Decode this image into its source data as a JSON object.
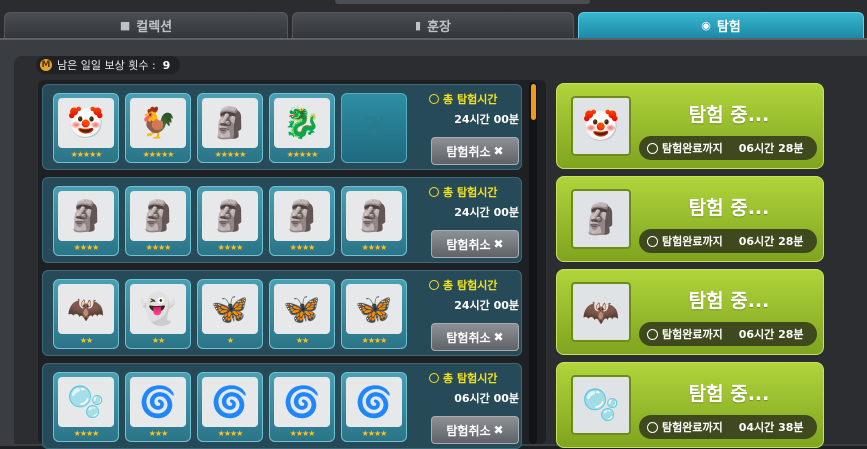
{
  "tabs": [
    {
      "label": "컬렉션",
      "icon": "box-icon"
    },
    {
      "label": "훈장",
      "icon": "bookmark-icon"
    },
    {
      "label": "탐험",
      "icon": "map-pin-icon"
    }
  ],
  "reward": {
    "label": "남은 일일 보상 횟수 :",
    "count": "9",
    "coin_letter": "M"
  },
  "rows": [
    {
      "time_label": "총 탐험시간",
      "time_value": "24시간 00분",
      "cancel": "탐험취소",
      "slots": [
        {
          "stars": "★★★★★"
        },
        {
          "stars": "★★★★★"
        },
        {
          "stars": "★★★★★"
        },
        {
          "stars": "★★★★★"
        },
        {
          "empty": true
        }
      ]
    },
    {
      "time_label": "총 탐험시간",
      "time_value": "24시간 00분",
      "cancel": "탐험취소",
      "slots": [
        {
          "stars": "★★★★"
        },
        {
          "stars": "★★★★"
        },
        {
          "stars": "★★★★"
        },
        {
          "stars": "★★★★"
        },
        {
          "stars": "★★★★"
        }
      ]
    },
    {
      "time_label": "총 탐험시간",
      "time_value": "24시간 00분",
      "cancel": "탐험취소",
      "slots": [
        {
          "stars": "★★"
        },
        {
          "stars": "★★"
        },
        {
          "stars": "★"
        },
        {
          "stars": "★★"
        },
        {
          "stars": "★★★★"
        }
      ]
    },
    {
      "time_label": "총 탐험시간",
      "time_value": "06시간 00분",
      "cancel": "탐험취소",
      "slots": [
        {
          "stars": "★★★★"
        },
        {
          "stars": "★★★"
        },
        {
          "stars": "★★★★"
        },
        {
          "stars": "★★★★"
        },
        {
          "stars": "★★★★"
        }
      ]
    }
  ],
  "cards": [
    {
      "title": "탐험 중...",
      "until": "탐험완료까지",
      "remain": "06시간 28분"
    },
    {
      "title": "탐험 중...",
      "until": "탐험완료까지",
      "remain": "06시간 28분"
    },
    {
      "title": "탐험 중...",
      "until": "탐험완료까지",
      "remain": "06시간 28분"
    },
    {
      "title": "탐험 중...",
      "until": "탐험완료까지",
      "remain": "04시간 38분"
    }
  ],
  "colors": {
    "accent": "#2aa3bf",
    "card_green": "#9cc52e",
    "time_yellow": "#f5e11a",
    "star": "#ffc21a",
    "scroll": "#f39a1b"
  }
}
